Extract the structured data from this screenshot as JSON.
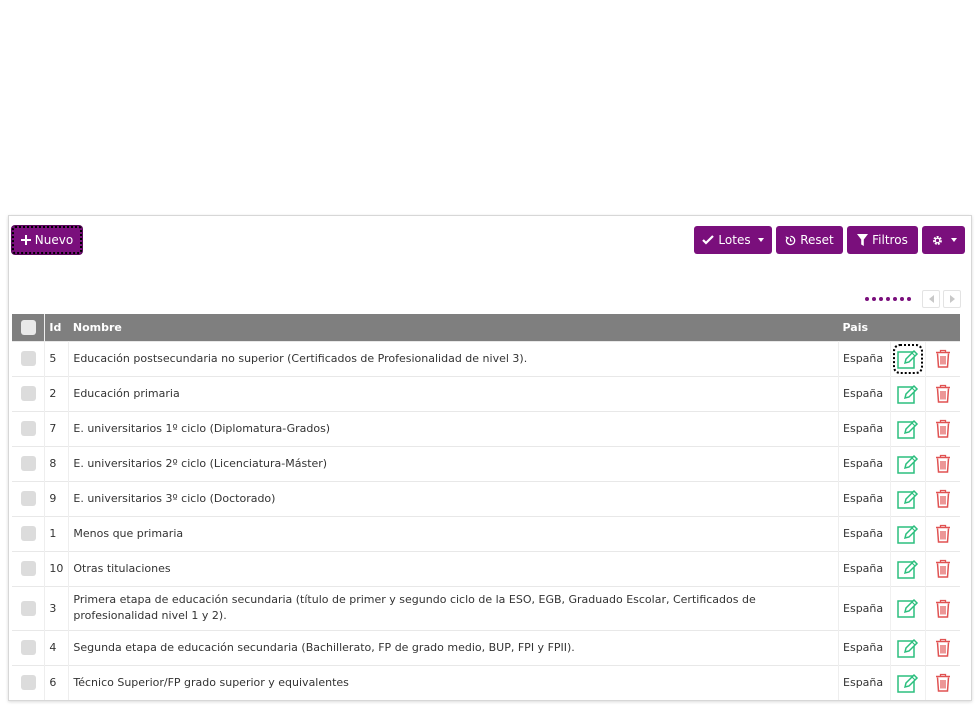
{
  "toolbar": {
    "new_label": "Nuevo",
    "lotes_label": "Lotes",
    "reset_label": "Reset",
    "filtros_label": "Filtros"
  },
  "table": {
    "headers": {
      "id": "Id",
      "name": "Nombre",
      "country": "Pais"
    },
    "rows": [
      {
        "id": "5",
        "name": "Educación postsecundaria no superior (Certificados de Profesionalidad de nivel 3).",
        "country": "España"
      },
      {
        "id": "2",
        "name": "Educación primaria",
        "country": "España"
      },
      {
        "id": "7",
        "name": "E. universitarios 1º ciclo (Diplomatura-Grados)",
        "country": "España"
      },
      {
        "id": "8",
        "name": "E. universitarios 2º ciclo (Licenciatura-Máster)",
        "country": "España"
      },
      {
        "id": "9",
        "name": "E. universitarios 3º ciclo (Doctorado)",
        "country": "España"
      },
      {
        "id": "1",
        "name": "Menos que primaria",
        "country": "España"
      },
      {
        "id": "10",
        "name": "Otras titulaciones",
        "country": "España"
      },
      {
        "id": "3",
        "name": "Primera etapa de educación secundaria (título de primer y segundo ciclo de la ESO, EGB, Graduado Escolar, Certificados de profesionalidad nivel 1 y 2).",
        "country": "España"
      },
      {
        "id": "4",
        "name": "Segunda etapa de educación secundaria (Bachillerato, FP de grado medio, BUP, FPI y FPII).",
        "country": "España"
      },
      {
        "id": "6",
        "name": "Técnico Superior/FP grado superior y equivalentes",
        "country": "España"
      }
    ]
  },
  "colors": {
    "accent": "#7a0f7c",
    "edit": "#2bbf7e",
    "delete": "#e05252",
    "header_bg": "#7f7f7f"
  },
  "icons": [
    "plus-icon",
    "check-icon",
    "reset-icon",
    "filter-icon",
    "gear-icon",
    "edit-icon",
    "trash-icon"
  ]
}
